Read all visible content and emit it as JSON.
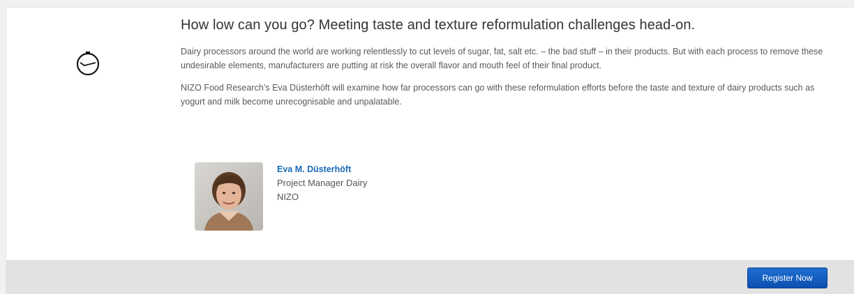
{
  "session": {
    "title": "How low can you go? Meeting taste and texture reformulation challenges head-on.",
    "paragraphs": [
      "Dairy processors around the world are working relentlessly to cut levels of sugar, fat, salt etc. – the bad stuff – in their products. But with each process to remove these undesirable elements, manufacturers are putting at risk the overall flavor and mouth feel of their final product.",
      "NIZO Food Research’s Eva Düsterhöft  will examine how far processors can go with these reformulation efforts before the taste and texture of dairy products such as yogurt and milk become unrecognisable and unpalatable."
    ],
    "icon": "clock-icon"
  },
  "speaker": {
    "name": "Eva M. Düsterhöft",
    "role": "Project Manager Dairy",
    "company": "NIZO"
  },
  "footer": {
    "register_label": "Register Now"
  },
  "colors": {
    "link": "#1a6ab8",
    "button": "#1464c8",
    "footer_bg": "#e2e2e2"
  }
}
